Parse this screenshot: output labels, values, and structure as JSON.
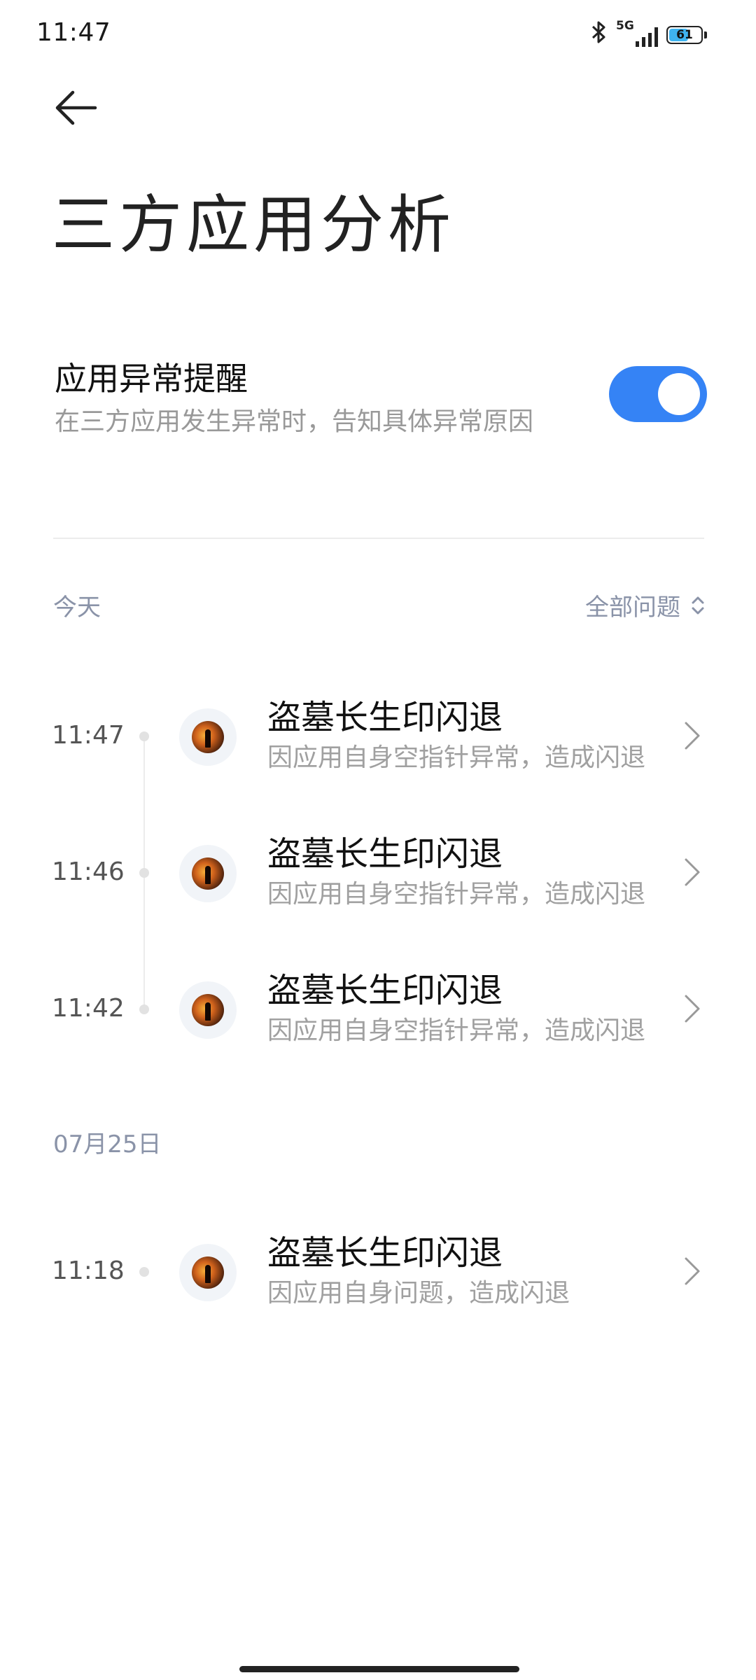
{
  "status_bar": {
    "time": "11:47",
    "network": "5G",
    "battery": "61",
    "battery_level": 0.61,
    "icons": [
      "bluetooth-icon",
      "signal-icon",
      "battery-icon"
    ]
  },
  "header": {
    "back_icon": "arrow-left-icon",
    "title": "三方应用分析"
  },
  "setting": {
    "title": "应用异常提醒",
    "description": "在三方应用发生异常时，告知具体异常原因",
    "enabled": true,
    "accent_color": "#3583f5"
  },
  "filter": {
    "label": "全部问题",
    "icon": "unfold-icon"
  },
  "groups": [
    {
      "label": "今天",
      "items": [
        {
          "time": "11:47",
          "title": "盗墓长生印闪退",
          "description": "因应用自身空指针异常，造成闪退"
        },
        {
          "time": "11:46",
          "title": "盗墓长生印闪退",
          "description": "因应用自身空指针异常，造成闪退"
        },
        {
          "time": "11:42",
          "title": "盗墓长生印闪退",
          "description": "因应用自身空指针异常，造成闪退"
        }
      ]
    },
    {
      "label": "07月25日",
      "items": [
        {
          "time": "11:18",
          "title": "盗墓长生印闪退",
          "description": "因应用自身问题，造成闪退"
        }
      ]
    }
  ]
}
